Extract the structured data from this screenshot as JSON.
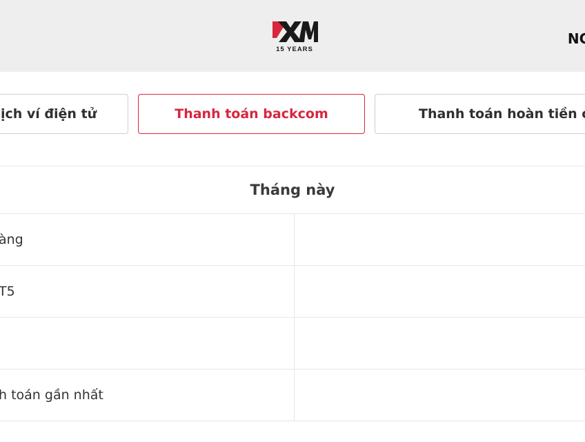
{
  "header": {
    "logo_text": "XM",
    "logo_sub": "15 YEARS",
    "right_text": "NG"
  },
  "tabs": [
    {
      "label": "ịch ví điện tử"
    },
    {
      "label": "Thanh toán backcom",
      "active": true
    },
    {
      "label": "Thanh toán hoàn tiền chi"
    }
  ],
  "table": {
    "header": "Tháng này",
    "rows": [
      {
        "left": "àng",
        "right": ""
      },
      {
        "left": "T5",
        "right": ""
      },
      {
        "left": "",
        "right": ""
      },
      {
        "left": "h toán gần nhất",
        "right": ""
      }
    ]
  },
  "colors": {
    "accent": "#d7263d",
    "header_bg": "#eeeeee",
    "border": "#e6e6e6"
  }
}
